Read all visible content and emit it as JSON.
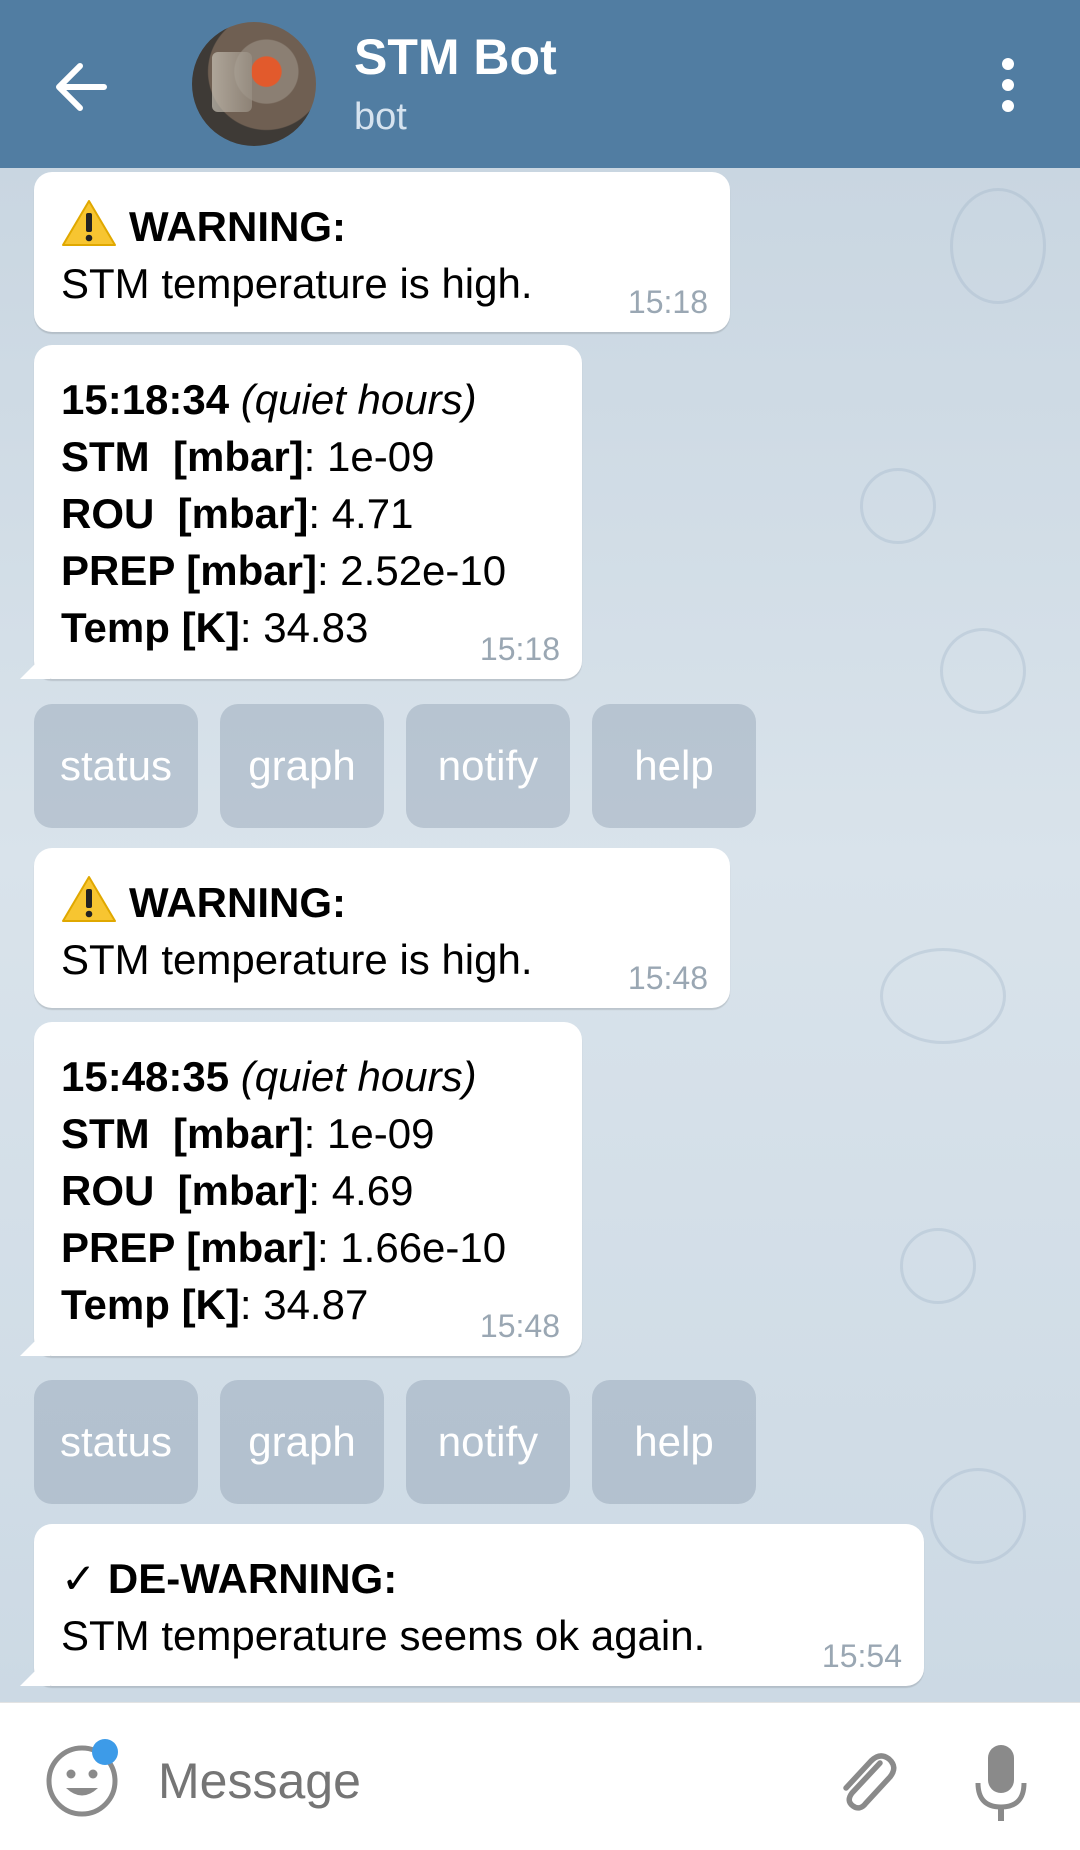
{
  "header": {
    "title": "STM Bot",
    "subtitle": "bot"
  },
  "messages": [
    {
      "kind": "warning",
      "heading": "WARNING:",
      "text": "STM temperature is high.",
      "time": "15:18"
    },
    {
      "kind": "status",
      "stamp": "15:18:34",
      "note": "(quiet hours)",
      "rows": [
        {
          "label": "STM  [mbar]",
          "value": ": 1e-09"
        },
        {
          "label": "ROU  [mbar]",
          "value": ": 4.71"
        },
        {
          "label": "PREP [mbar]",
          "value": ": 2.52e-10"
        },
        {
          "label": "Temp [K]",
          "value": ": 34.83"
        }
      ],
      "time": "15:18"
    },
    {
      "kind": "warning",
      "heading": "WARNING:",
      "text": "STM temperature is high.",
      "time": "15:48"
    },
    {
      "kind": "status",
      "stamp": "15:48:35",
      "note": "(quiet hours)",
      "rows": [
        {
          "label": "STM  [mbar]",
          "value": ": 1e-09"
        },
        {
          "label": "ROU  [mbar]",
          "value": ": 4.69"
        },
        {
          "label": "PREP [mbar]",
          "value": ": 1.66e-10"
        },
        {
          "label": "Temp [K]",
          "value": ": 34.87"
        }
      ],
      "time": "15:48"
    },
    {
      "kind": "dewarning",
      "heading": "DE-WARNING:",
      "check": "✓",
      "text": "STM temperature seems ok again.",
      "time": "15:54"
    }
  ],
  "keyboard_rows": [
    [
      "status",
      "graph",
      "notify",
      "help"
    ],
    [
      "status",
      "graph",
      "notify",
      "help"
    ]
  ],
  "input": {
    "placeholder": "Message"
  },
  "colors": {
    "header": "#517da2",
    "warning_icon": "#f7c531",
    "unread_dot": "#3d9be8"
  },
  "icons": [
    "back-arrow-icon",
    "more-vertical-icon",
    "warning-icon",
    "smiley-icon",
    "paperclip-icon",
    "microphone-icon"
  ]
}
